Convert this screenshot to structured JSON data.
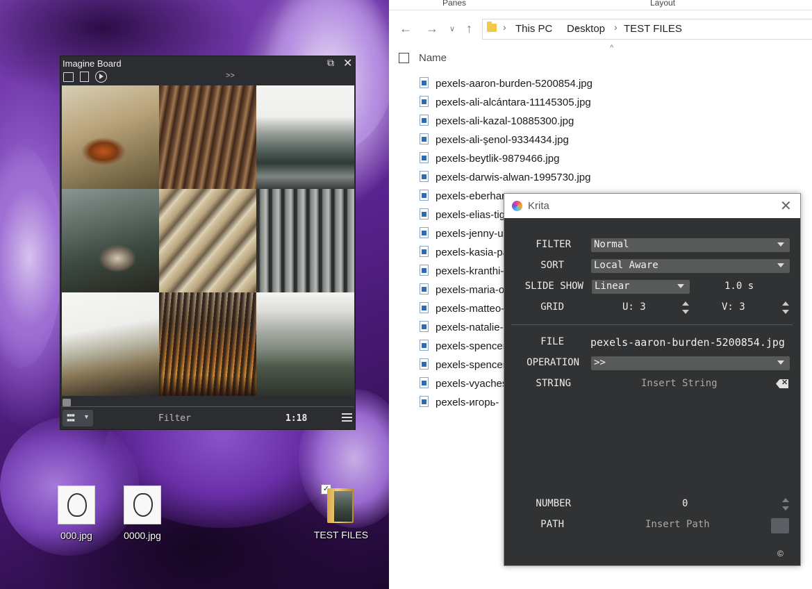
{
  "explorer": {
    "ribbon": {
      "panes": "Panes",
      "layout": "Layout"
    },
    "breadcrumb": [
      "This PC",
      "Desktop",
      "TEST FILES"
    ],
    "column_header": "Name",
    "files": [
      "pexels-aaron-burden-5200854.jpg",
      "pexels-ali-alcántara-11145305.jpg",
      "pexels-ali-kazal-10885300.jpg",
      "pexels-ali-şenol-9334434.jpg",
      "pexels-beytlik-9879466.jpg",
      "pexels-darwis-alwan-1995730.jpg",
      "pexels-eberhar",
      "pexels-elias-tig",
      "pexels-jenny-u",
      "pexels-kasia-pa",
      "pexels-kranthi-",
      "pexels-maria-o",
      "pexels-matteo-",
      "pexels-natalie-",
      "pexels-spencer",
      "pexels-spencer",
      "pexels-vyaches",
      "pexels-игорь-"
    ]
  },
  "imagine_board": {
    "title": "Imagine Board",
    "arrows": ">>",
    "filter_label": "Filter",
    "count": "1:18",
    "icons": [
      "folder-icon",
      "file-image-icon",
      "play-icon",
      "restore-icon",
      "close-icon",
      "grid-view-icon",
      "hamburger-menu-icon"
    ]
  },
  "desktop_icons": [
    {
      "label": "000.jpg"
    },
    {
      "label": "0000.jpg"
    },
    {
      "label": "TEST FILES"
    }
  ],
  "krita": {
    "title": "Krita",
    "filter": {
      "label": "FILTER",
      "value": "Normal"
    },
    "sort": {
      "label": "SORT",
      "value": "Local Aware"
    },
    "slideshow": {
      "label": "SLIDE SHOW",
      "mode": "Linear",
      "interval": "1.0 s"
    },
    "grid": {
      "label": "GRID",
      "u": "U: 3",
      "v": "V: 3"
    },
    "file": {
      "label": "FILE",
      "value": "pexels-aaron-burden-5200854.jpg"
    },
    "operation": {
      "label": "OPERATION",
      "value": ">>"
    },
    "string": {
      "label": "STRING",
      "placeholder": "Insert String"
    },
    "number": {
      "label": "NUMBER",
      "value": "0"
    },
    "path": {
      "label": "PATH",
      "placeholder": "Insert Path"
    },
    "copyright": "©"
  },
  "colors": {
    "panel_bg": "#303234",
    "combo_bg": "#575a57",
    "imagine_bg": "#2b2d30",
    "accent_purple": "#6a44b0",
    "folder_yellow": "#f3c94a"
  }
}
